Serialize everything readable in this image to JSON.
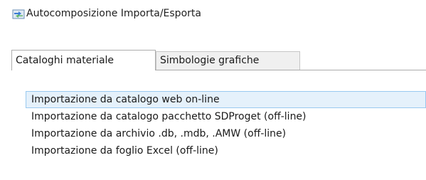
{
  "window": {
    "title": "Autocomposizione Importa/Esporta",
    "icon": "import-export-icon"
  },
  "tabs": [
    {
      "label": "Cataloghi materiale",
      "active": true
    },
    {
      "label": "Simbologie grafiche",
      "active": false
    }
  ],
  "list": {
    "items": [
      {
        "label": "Importazione da catalogo web on-line",
        "selected": true
      },
      {
        "label": "Importazione da catalogo pacchetto SDProget (off-line)",
        "selected": false
      },
      {
        "label": "Importazione da archivio .db, .mdb, .AMW (off-line)",
        "selected": false
      },
      {
        "label": "Importazione da foglio Excel (off-line)",
        "selected": false
      }
    ]
  },
  "colors": {
    "selection_background": "#e5f1fb",
    "selection_border": "#99c9f0",
    "inactive_tab_background": "#f0f0f0"
  }
}
